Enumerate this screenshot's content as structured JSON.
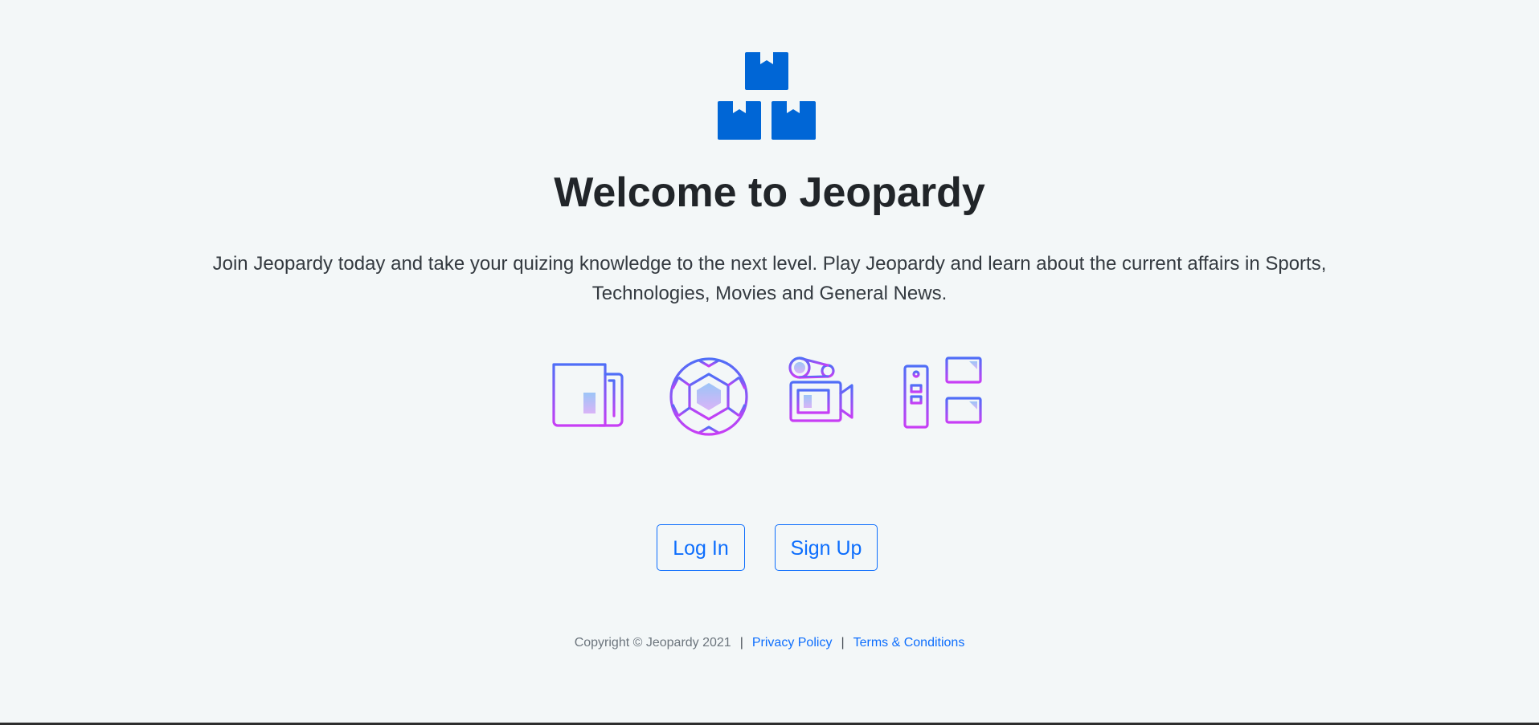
{
  "hero": {
    "title": "Welcome to Jeopardy",
    "lead": "Join Jeopardy today and take your quizing knowledge to the next level. Play Jeopardy and learn about the current affairs in Sports, Technologies, Movies and General News."
  },
  "icons": [
    {
      "name": "newspaper-icon"
    },
    {
      "name": "soccer-ball-icon"
    },
    {
      "name": "movie-camera-icon"
    },
    {
      "name": "computer-network-icon"
    }
  ],
  "actions": {
    "login_label": "Log In",
    "signup_label": "Sign Up"
  },
  "footer": {
    "copyright": "Copyright © Jeopardy 2021",
    "separator": "|",
    "privacy_label": "Privacy Policy",
    "terms_label": "Terms & Conditions"
  },
  "colors": {
    "brand": "#0d6efd",
    "background": "#f3f7f8",
    "gradient_start": "#4f6ef7",
    "gradient_end": "#c83ef5"
  }
}
